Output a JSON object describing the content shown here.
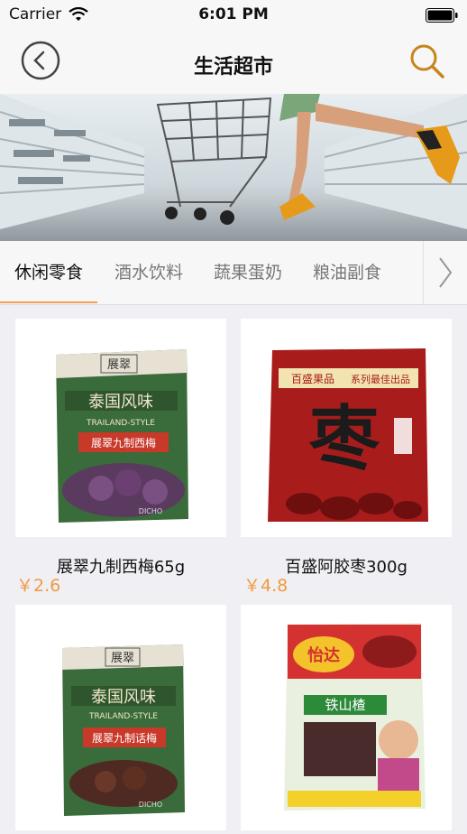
{
  "status": {
    "carrier": "Carrier",
    "time": "6:01 PM"
  },
  "nav": {
    "title": "生活超市"
  },
  "tabs": [
    {
      "label": "休闲零食",
      "active": true
    },
    {
      "label": "酒水饮料"
    },
    {
      "label": "蔬果蛋奶"
    },
    {
      "label": "粮油副食"
    }
  ],
  "products": [
    {
      "name": "展翠九制西梅65g",
      "price": "￥2.6",
      "package_text": [
        "展翠",
        "泰国风味",
        "TRAILAND-STYLE",
        "展翠九制西梅",
        "DICHO"
      ]
    },
    {
      "name": "百盛阿胶枣300g",
      "price": "￥4.8",
      "package_text": [
        "百盛果品",
        "系列最佳出品",
        "枣"
      ]
    },
    {
      "name": "",
      "price": "",
      "package_text": [
        "展翠",
        "泰国风味",
        "TRAILAND-STYLE",
        "展翠九制话梅",
        "DICHO"
      ]
    },
    {
      "name": "",
      "price": "",
      "package_text": [
        "怡达",
        "铁山楂"
      ]
    }
  ],
  "colors": {
    "accent": "#f39a3e",
    "navBg": "#f7f7f7",
    "pageBg": "#efeff4"
  }
}
